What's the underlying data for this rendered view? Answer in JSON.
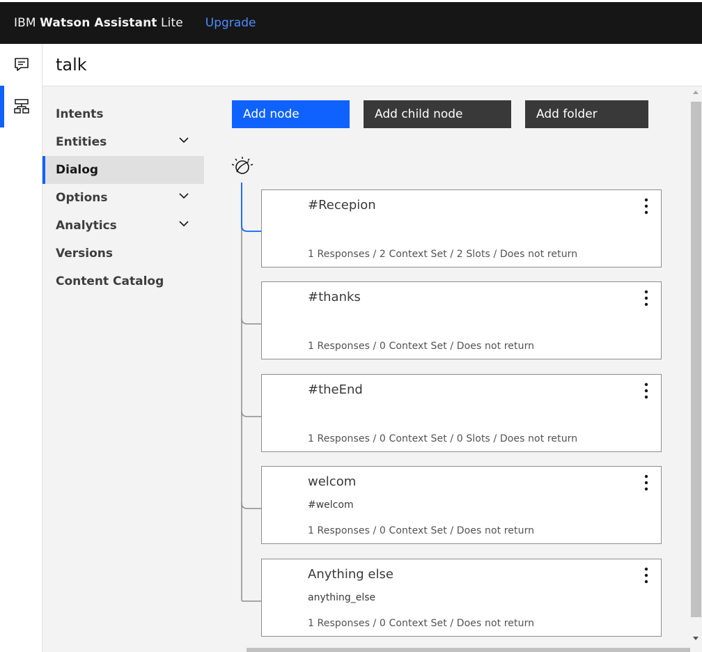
{
  "topbar": {
    "brand_prefix": "IBM",
    "brand_name": "Watson Assistant",
    "brand_plan": "Lite",
    "upgrade_label": "Upgrade"
  },
  "rail": {
    "items": [
      {
        "icon": "chat-icon"
      },
      {
        "icon": "dialog-tree-icon",
        "active": true
      }
    ]
  },
  "header": {
    "skill_name": "talk"
  },
  "nav": {
    "items": [
      {
        "label": "Intents",
        "has_chevron": false
      },
      {
        "label": "Entities",
        "has_chevron": true
      },
      {
        "label": "Dialog",
        "has_chevron": false,
        "active": true
      },
      {
        "label": "Options",
        "has_chevron": true
      },
      {
        "label": "Analytics",
        "has_chevron": true
      },
      {
        "label": "Versions",
        "has_chevron": false
      },
      {
        "label": "Content Catalog",
        "has_chevron": false
      }
    ]
  },
  "toolbar": {
    "add_node_label": "Add node",
    "add_child_node_label": "Add child node",
    "add_folder_label": "Add folder"
  },
  "dialog_nodes": [
    {
      "title": "#Recepion",
      "condition": "",
      "summary": "1 Responses / 2 Context Set / 2 Slots / Does not return",
      "selected": true
    },
    {
      "title": "#thanks",
      "condition": "",
      "summary": "1 Responses / 0 Context Set / Does not return"
    },
    {
      "title": "#theEnd",
      "condition": "",
      "summary": "1 Responses / 0 Context Set / 0 Slots / Does not return"
    },
    {
      "title": "welcom",
      "condition": "#welcom",
      "summary": "1 Responses / 0 Context Set / Does not return"
    },
    {
      "title": "Anything else",
      "condition": "anything_else",
      "summary": "1 Responses / 0 Context Set / Does not return"
    }
  ],
  "colors": {
    "accent": "#0f62fe",
    "topbar_bg": "#161616",
    "upgrade_link": "#4d8dfd",
    "dark_button": "#393939",
    "content_bg": "#f3f3f3"
  }
}
